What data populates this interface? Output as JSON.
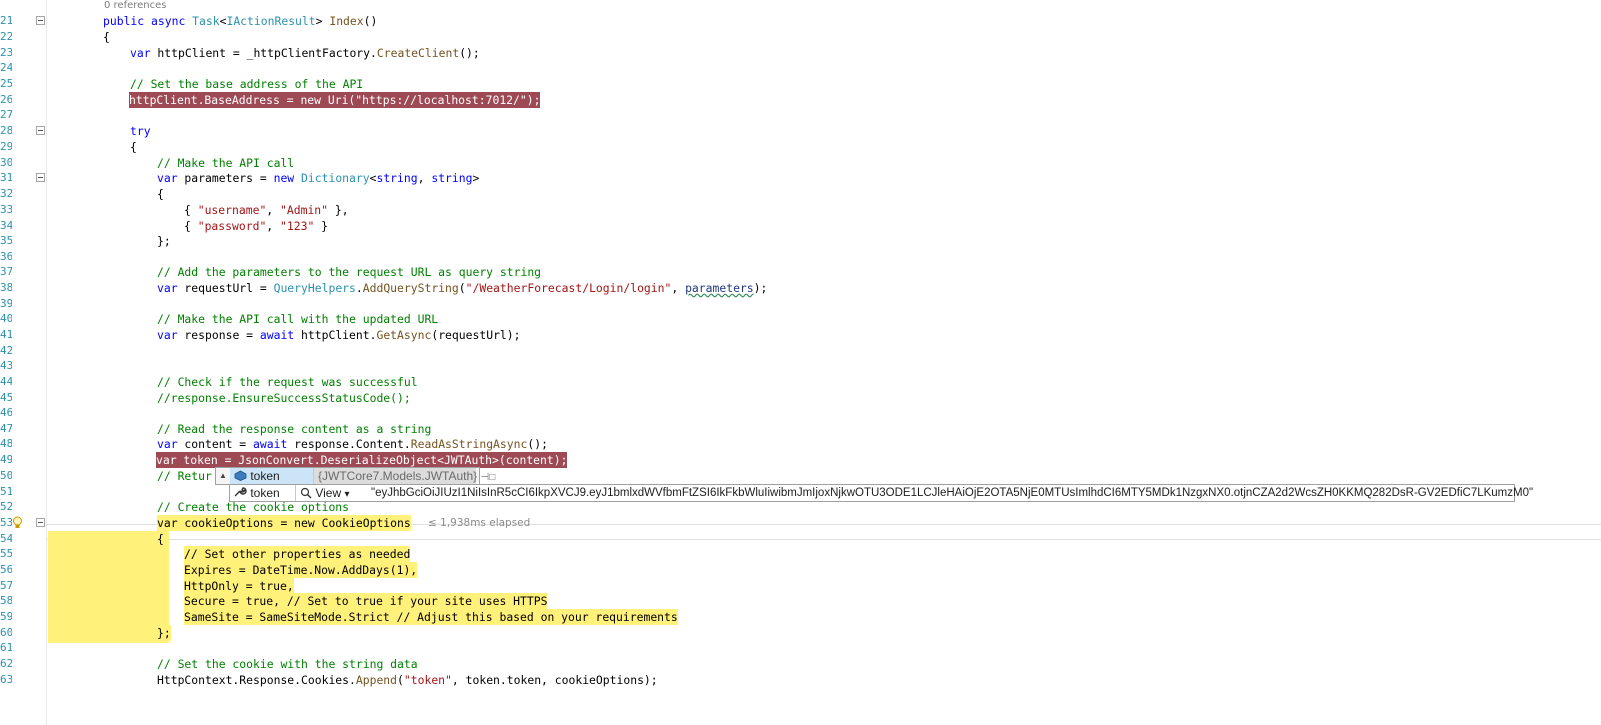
{
  "editor": {
    "line_numbers": [
      "21",
      "22",
      "23",
      "24",
      "25",
      "26",
      "27",
      "28",
      "29",
      "30",
      "31",
      "32",
      "33",
      "34",
      "35",
      "36",
      "37",
      "38",
      "39",
      "40",
      "41",
      "42",
      "43",
      "44",
      "45",
      "46",
      "47",
      "48",
      "49",
      "50",
      "51",
      "52",
      "53",
      "54",
      "55",
      "56",
      "57",
      "58",
      "59",
      "60",
      "61",
      "62",
      "63"
    ],
    "codelens_references": "0 references",
    "elapsed_hint": "≤ 1,938ms elapsed",
    "lines": {
      "l21": {
        "kw1": "public",
        "kw2": "async",
        "type": "Task",
        "lt": "<",
        "type2": "IActionResult",
        "gt": ">",
        "method": "Index",
        "rest": "()"
      },
      "l22": "{",
      "l23": {
        "kw": "var",
        "rest1": " httpClient = _httpClientFactory.",
        "method": "CreateClient",
        "rest2": "();"
      },
      "l25": "// Set the base address of the API",
      "l26": "httpClient.BaseAddress = new Uri(\"https://localhost:7012/\");",
      "l28": "try",
      "l29": "{",
      "l30": "// Make the API call",
      "l31": {
        "kw": "var",
        "rest1": " parameters = ",
        "kw2": "new",
        "type": "Dictionary",
        "lt": "<",
        "kw3": "string",
        "comma": ", ",
        "kw4": "string",
        "gt": ">"
      },
      "l32": "{",
      "l33": {
        "open": "{ ",
        "s1": "\"username\"",
        "comma": ", ",
        "s2": "\"Admin\"",
        "close": " },"
      },
      "l34": {
        "open": "{ ",
        "s1": "\"password\"",
        "comma": ", ",
        "s2": "\"123\"",
        "close": " }"
      },
      "l35": "};",
      "l37": "// Add the parameters to the request URL as query string",
      "l38": {
        "kw": "var",
        "rest1": " requestUrl = ",
        "type": "QueryHelpers",
        "dot": ".",
        "method": "AddQueryString",
        "paren": "(",
        "s1": "\"/WeatherForecast/Login/login\"",
        "comma": ", ",
        "param": "parameters",
        "end": ");"
      },
      "l40": "// Make the API call with the updated URL",
      "l41": {
        "kw": "var",
        "rest1": " response = ",
        "kw2": "await",
        "rest2": " httpClient.",
        "method": "GetAsync",
        "rest3": "(requestUrl);"
      },
      "l44": "// Check if the request was successful",
      "l45": "//response.EnsureSuccessStatusCode();",
      "l47": "// Read the response content as a string",
      "l48": {
        "kw": "var",
        "rest1": " content = ",
        "kw2": "await",
        "rest2": " response.Content.",
        "method": "ReadAsStringAsync",
        "rest3": "();"
      },
      "l49": "var token = JsonConvert.DeserializeObject<JWTAuth>(content);",
      "l50": "// Retur",
      "l51": "// Create the cookie options",
      "l52": "var cookieOptions = new CookieOptions",
      "l53": "{",
      "l54": "// Set other properties as needed",
      "l55": "Expires = DateTime.Now.AddDays(1),",
      "l56": "HttpOnly = true,",
      "l57": "Secure = true, // Set to true if your site uses HTTPS",
      "l58": "SameSite = SameSiteMode.Strict // Adjust this based on your requirements",
      "l59": "};",
      "l61": "// Set the cookie with the string data",
      "l62": {
        "rest1": "HttpContext.Response.Cookies.",
        "method": "Append",
        "paren": "(",
        "s1": "\"token\"",
        "rest2": ", token.token, cookieOptions);"
      }
    }
  },
  "datatip": {
    "row1": {
      "expander": "▲",
      "name": "token",
      "value": "{JWTCore7.Models.JWTAuth}",
      "pin": "⊣□"
    },
    "row2": {
      "name": "token",
      "view_label": "View",
      "view_arrow": "▾",
      "value": "\"eyJhbGciOiJIUzI1NiIsInR5cCI6IkpXVCJ9.eyJ1bmlxdWVfbmFtZSI6IkFkbWluIiwibmJmIjoxNjkwOTU3ODE1LCJleHAiOjE2OTA5NjE0MTUsImlhdCI6MTY5MDk1NzgxNX0.otjnCZA2d2WcsZH0KKMQ282DsR-GV2EDfiC7LKumzM0\""
    }
  }
}
